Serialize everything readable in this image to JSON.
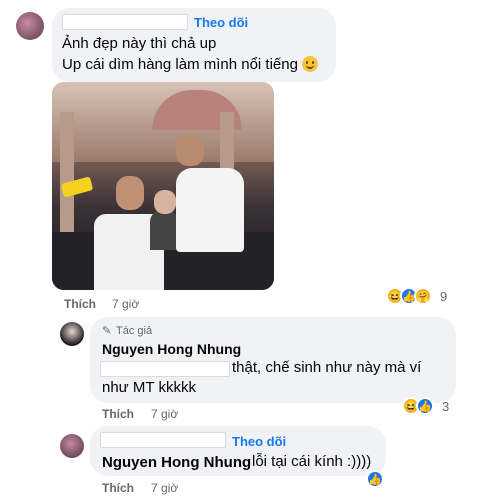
{
  "comment1": {
    "follow_label": "Theo dõi",
    "lines": [
      "Ảnh đẹp này thì chả up",
      "Up cái dìm hàng làm mình nổi tiếng"
    ],
    "like_label": "Thích",
    "time": "7 giờ",
    "reaction_count": "9"
  },
  "reply1": {
    "author_badge": "Tác giả",
    "author_name": "Nguyen Hong Nhung",
    "line1_suffix": "thật, chế sinh như này mà ví",
    "line2": "như MT kkkkk",
    "like_label": "Thích",
    "time": "7 giờ",
    "reaction_count": "3"
  },
  "reply2": {
    "follow_label": "Theo dõi",
    "mention": "Nguyen Hong Nhung",
    "text": "lỗi tại cái kính :))))",
    "like_label": "Thích",
    "time": "7 giờ"
  },
  "colors": {
    "accent": "#1877f2",
    "bubble": "#f0f2f5",
    "meta": "#65676b"
  }
}
